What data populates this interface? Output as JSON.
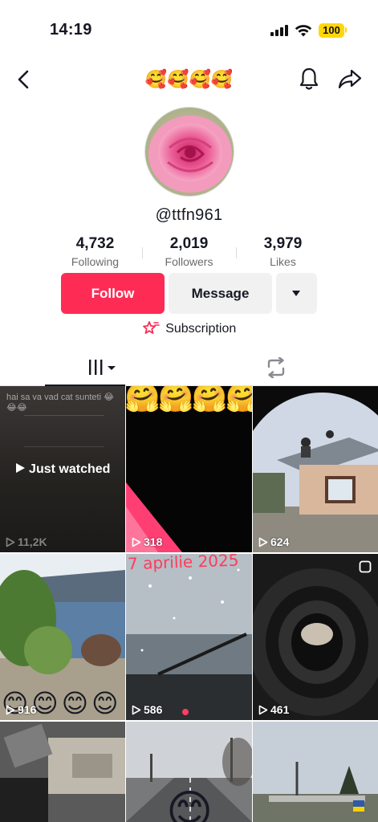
{
  "status_bar": {
    "time": "14:19",
    "battery": "100"
  },
  "header": {
    "title": "🥰🥰🥰🥰"
  },
  "profile": {
    "username": "@ttfn961",
    "stats": [
      {
        "value": "4,732",
        "label": "Following"
      },
      {
        "value": "2,019",
        "label": "Followers"
      },
      {
        "value": "3,979",
        "label": "Likes"
      }
    ],
    "follow_label": "Follow",
    "message_label": "Message",
    "subscription_label": "Subscription"
  },
  "videos": [
    {
      "count": "11,2K",
      "overlay": "Just watched",
      "caption": "hai sa va vad cat sunteti 😂😂😂"
    },
    {
      "count": "318",
      "emoji": "🤗🤗🤗🤗"
    },
    {
      "count": "624"
    },
    {
      "count": "916",
      "emoji": "😊😊😊😊"
    },
    {
      "count": "586",
      "caption": "7 aprilie 2025"
    },
    {
      "count": "461"
    },
    {
      "count": ""
    },
    {
      "count": "",
      "emoji": "😊"
    },
    {
      "count": ""
    }
  ],
  "colors": {
    "accent": "#fe2c55",
    "battery": "#ffd60a",
    "text": "#161823"
  }
}
